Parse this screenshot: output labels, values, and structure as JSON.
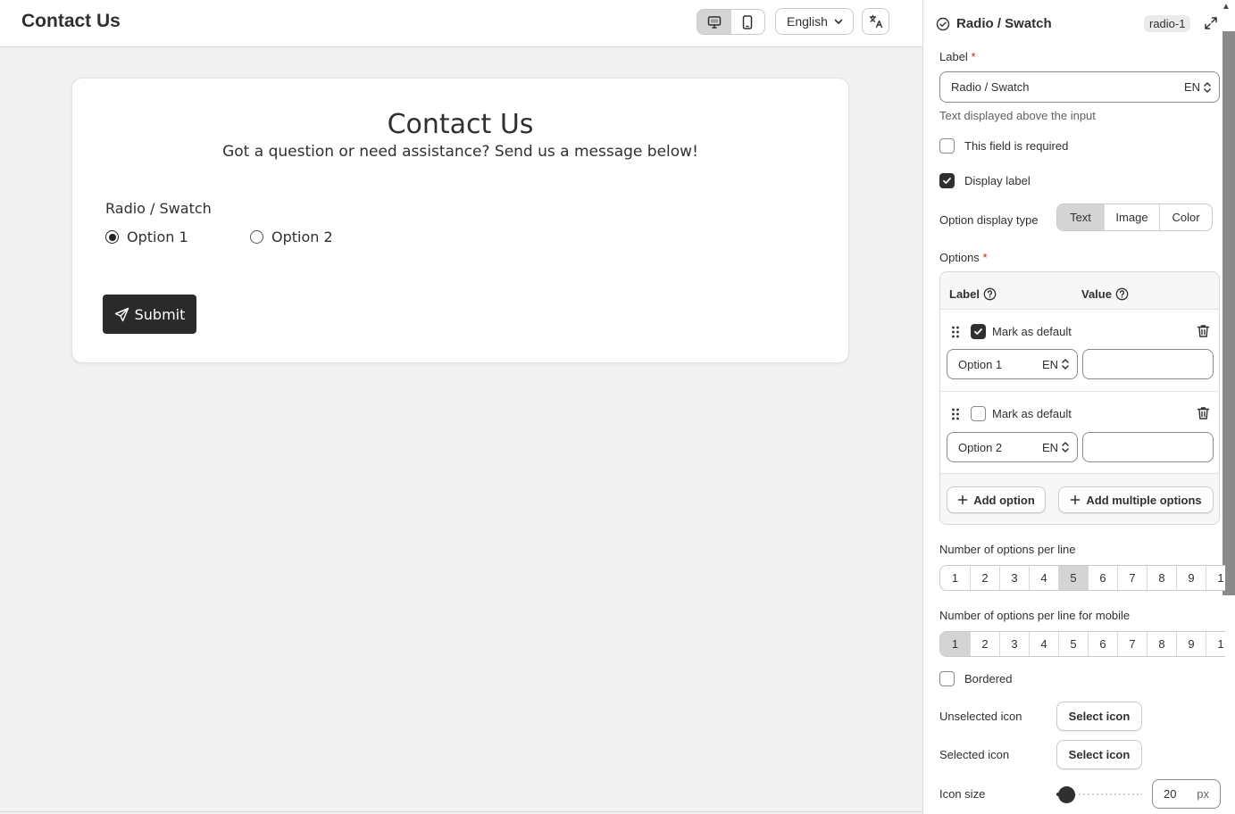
{
  "header": {
    "title": "Contact Us",
    "language": "English"
  },
  "form": {
    "title": "Contact Us",
    "subtitle": "Got a question or need assistance? Send us a message below!",
    "field_label": "Radio / Swatch",
    "options": [
      "Option 1",
      "Option 2"
    ],
    "selected_option": "Option 1",
    "submit_label": "Submit"
  },
  "panel": {
    "title": "Radio / Swatch",
    "id_badge": "radio-1",
    "label_field": {
      "label": "Label",
      "required_mark": "*",
      "value": "Radio / Swatch",
      "lang": "EN",
      "help": "Text displayed above the input"
    },
    "required_checkbox": {
      "label": "This field is required",
      "checked": false
    },
    "display_label_checkbox": {
      "label": "Display label",
      "checked": true
    },
    "option_display_type": {
      "label": "Option display type",
      "choices": [
        "Text",
        "Image",
        "Color"
      ],
      "selected": "Text"
    },
    "options_section": {
      "label": "Options",
      "required_mark": "*",
      "col_label": "Label",
      "col_value": "Value",
      "mark_default_label": "Mark as default",
      "items": [
        {
          "label": "Option 1",
          "lang": "EN",
          "value": "",
          "default": true
        },
        {
          "label": "Option 2",
          "lang": "EN",
          "value": "",
          "default": false
        }
      ],
      "add_option": "Add option",
      "add_multiple": "Add multiple options"
    },
    "per_line": {
      "label": "Number of options per line",
      "values": [
        "1",
        "2",
        "3",
        "4",
        "5",
        "6",
        "7",
        "8",
        "9",
        "1"
      ],
      "selected": "5"
    },
    "per_line_mobile": {
      "label": "Number of options per line for mobile",
      "values": [
        "1",
        "2",
        "3",
        "4",
        "5",
        "6",
        "7",
        "8",
        "9",
        "1"
      ],
      "selected": "1"
    },
    "bordered": {
      "label": "Bordered",
      "checked": false
    },
    "unselected_icon": {
      "label": "Unselected icon",
      "button": "Select icon"
    },
    "selected_icon": {
      "label": "Selected icon",
      "button": "Select icon"
    },
    "icon_size": {
      "label": "Icon size",
      "value": "20",
      "unit": "px",
      "slider_fraction": 0.12
    }
  },
  "icons": {
    "desktop": "desktop-icon",
    "mobile": "mobile-icon",
    "translate": "translate-icon",
    "send": "send-icon",
    "check_circle": "check-circle-icon",
    "expand": "expand-icon",
    "help": "help-circle-icon",
    "drag": "drag-handle-icon",
    "trash": "trash-icon",
    "plus": "plus-icon",
    "stepper": "select-stepper-icon"
  }
}
